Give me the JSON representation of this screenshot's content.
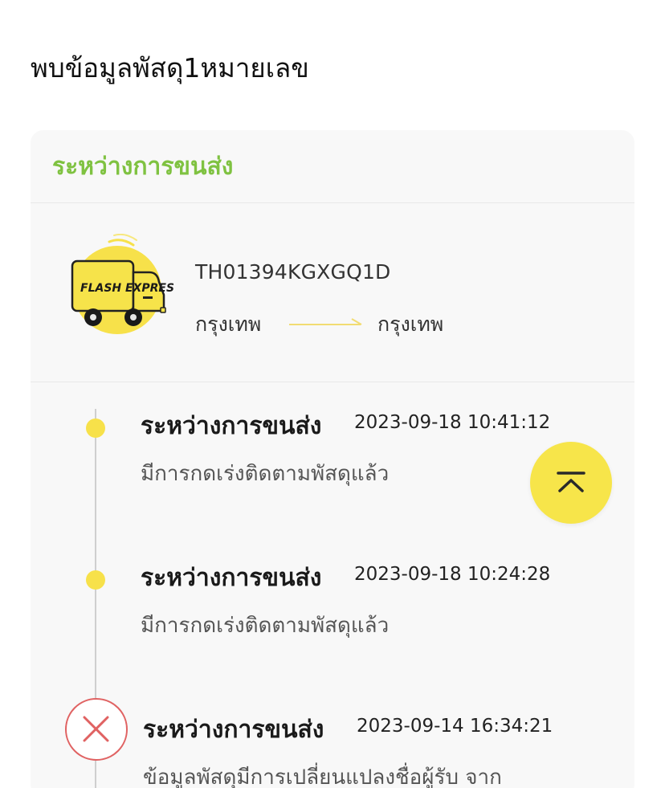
{
  "page": {
    "heading": "พบข้อมูลพัสดุ1หมายเลข"
  },
  "card": {
    "status": "ระหว่างการขนส่ง",
    "tracking_number": "TH01394KGXGQ1D",
    "origin": "กรุงเทพ",
    "destination": "กรุงเทพ",
    "truck_logo_text": "FLASH EXPRESS"
  },
  "timeline": [
    {
      "status": "ระหว่างการขนส่ง",
      "timestamp": "2023-09-18  10:41:12",
      "description": "มีการกดเร่งติดตามพัสดุแล้ว",
      "marker": "yellow-dot"
    },
    {
      "status": "ระหว่างการขนส่ง",
      "timestamp": "2023-09-18  10:24:28",
      "description": "มีการกดเร่งติดตามพัสดุแล้ว",
      "marker": "yellow-dot"
    },
    {
      "status": "ระหว่างการขนส่ง",
      "timestamp": "2023-09-14  16:34:21",
      "description": "ข้อมูลพัสดุมีการเปลี่ยนแปลงชื่อผู้รับ  จาก",
      "marker": "cancel-icon"
    }
  ],
  "colors": {
    "status_green": "#7fc241",
    "brand_yellow": "#f7e54a",
    "cancel_red": "#e06262"
  },
  "icons": {
    "scroll_top": "chevron-up-bar-icon",
    "cancel": "close-icon"
  }
}
